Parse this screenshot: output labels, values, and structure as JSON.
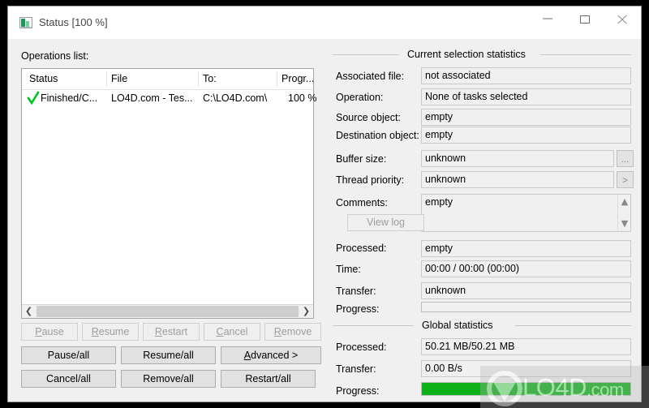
{
  "window": {
    "title": "Status [100 %]",
    "icon": "app-status-icon",
    "controls": {
      "minimize": "minimize-icon",
      "maximize": "maximize-icon",
      "close": "close-icon"
    }
  },
  "operations": {
    "label": "Operations list:",
    "columns": [
      "Status",
      "File",
      "To:",
      "Progr..."
    ],
    "rows": [
      {
        "status_icon": "green-check-icon",
        "status": "Finished/C...",
        "file": "LO4D.com - Tes...",
        "to": "C:\\LO4D.com\\",
        "progress": "100 %"
      }
    ],
    "scrollbar": {
      "left_arrow": "chevron-left-icon",
      "right_arrow": "chevron-right-icon"
    }
  },
  "task_buttons": [
    {
      "label": "Pause",
      "accel": "P",
      "enabled": false
    },
    {
      "label": "Resume",
      "accel": "R",
      "enabled": false
    },
    {
      "label": "Restart",
      "accel": "R",
      "enabled": false
    },
    {
      "label": "Cancel",
      "accel": "C",
      "enabled": false
    },
    {
      "label": "Remove",
      "accel": "R",
      "enabled": false
    }
  ],
  "all_buttons": {
    "pause_all": "Pause/all",
    "resume_all": "Resume/all",
    "advanced": "Advanced >",
    "cancel_all": "Cancel/all",
    "remove_all": "Remove/all",
    "restart_all": "Restart/all"
  },
  "selection_stats": {
    "group_title": "Current selection statistics",
    "fields": [
      {
        "label": "Associated file:",
        "value": "not associated"
      },
      {
        "label": "Operation:",
        "value": "None of tasks selected"
      },
      {
        "label": "Source object:",
        "value": "empty"
      },
      {
        "label": "Destination object:",
        "value": "empty"
      },
      {
        "label": "Buffer size:",
        "value": "unknown"
      },
      {
        "label": "Thread priority:",
        "value": "unknown"
      },
      {
        "label": "Comments:",
        "value": "empty"
      },
      {
        "label": "Processed:",
        "value": "empty"
      },
      {
        "label": "Time:",
        "value": "00:00 / 00:00 (00:00)"
      },
      {
        "label": "Transfer:",
        "value": "unknown"
      },
      {
        "label": "Progress:",
        "value": ""
      }
    ],
    "buffer_browse_label": "...",
    "thread_browse_label": ">",
    "view_log_label": "View log",
    "progress_percent": 0,
    "scroll_up": "chevron-up-icon",
    "scroll_down": "chevron-down-icon"
  },
  "global_stats": {
    "group_title": "Global statistics",
    "fields": [
      {
        "label": "Processed:",
        "value": "50.21 MB/50.21 MB"
      },
      {
        "label": "Transfer:",
        "value": "0.00 B/s"
      },
      {
        "label": "Progress:",
        "value": ""
      }
    ],
    "progress_percent": 100,
    "progress_color": "#0cb019"
  },
  "watermark": {
    "text": "LO4D",
    "suffix": ".com"
  }
}
